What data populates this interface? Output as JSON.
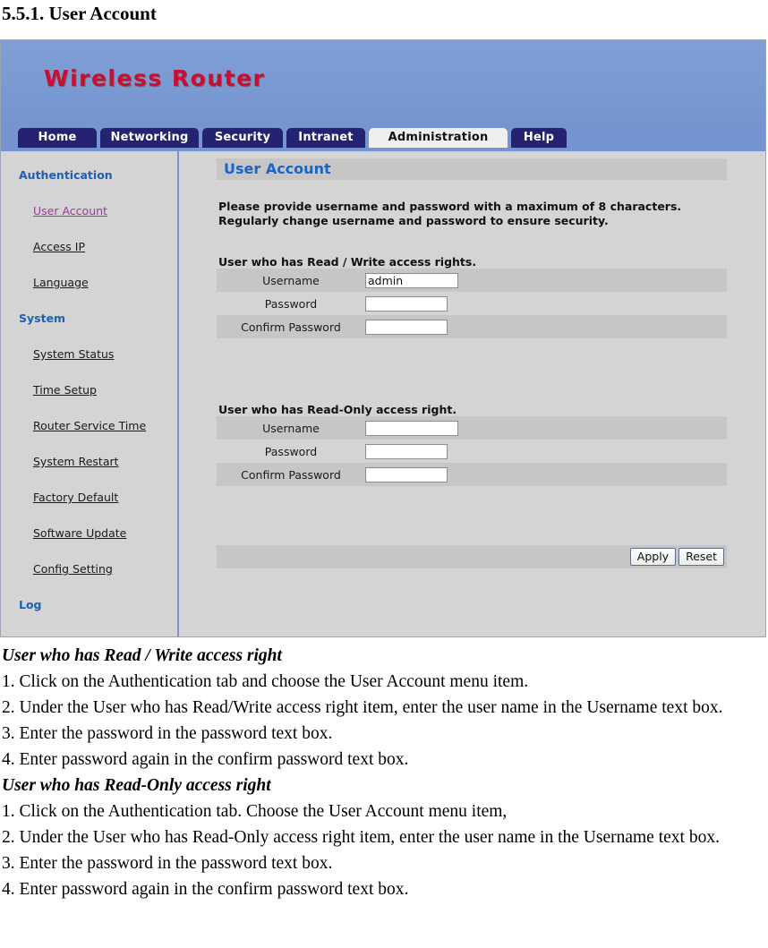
{
  "document": {
    "heading": "5.5.1. User Account"
  },
  "router_ui": {
    "brand": "Wireless Router",
    "nav_tabs": [
      {
        "label": "Home",
        "active": false
      },
      {
        "label": "Networking",
        "active": false
      },
      {
        "label": "Security",
        "active": false
      },
      {
        "label": "Intranet",
        "active": false
      },
      {
        "label": "Administration",
        "active": true
      },
      {
        "label": "Help",
        "active": false
      }
    ],
    "sidebar": {
      "groups": [
        {
          "title": "Authentication",
          "items": [
            {
              "label": "User Account",
              "current": true
            },
            {
              "label": "Access IP",
              "current": false
            },
            {
              "label": "Language",
              "current": false
            }
          ]
        },
        {
          "title": "System",
          "items": [
            {
              "label": "System Status",
              "current": false
            },
            {
              "label": "Time Setup",
              "current": false
            },
            {
              "label": "Router Service Time",
              "current": false
            },
            {
              "label": "System Restart",
              "current": false
            },
            {
              "label": "Factory Default",
              "current": false
            },
            {
              "label": "Software Update",
              "current": false
            },
            {
              "label": "Config Setting",
              "current": false
            }
          ]
        },
        {
          "title": "Log",
          "items": []
        }
      ]
    },
    "panel": {
      "title": "User Account",
      "intro_line1": "Please provide username and password with a maximum of 8 characters.",
      "intro_line2": "Regularly change username and password to ensure security.",
      "rw_group_label": "User who has Read / Write access rights.",
      "ro_group_label": "User who has Read-Only access right.",
      "rw_fields": [
        {
          "label": "Username",
          "value": "admin",
          "placeholder": ""
        },
        {
          "label": "Password",
          "value": "",
          "placeholder": ""
        },
        {
          "label": "Confirm Password",
          "value": "",
          "placeholder": ""
        }
      ],
      "ro_fields": [
        {
          "label": "Username",
          "value": "",
          "placeholder": ""
        },
        {
          "label": "Password",
          "value": "",
          "placeholder": ""
        },
        {
          "label": "Confirm Password",
          "value": "",
          "placeholder": ""
        }
      ],
      "apply_label": "Apply",
      "reset_label": "Reset"
    },
    "colors": {
      "tab_inactive_bg": "#232372",
      "tab_active_bg": "#efefef",
      "header_bg": "#7694cf",
      "brand_text": "#c8102e",
      "panel_title_text": "#1864c8",
      "sidebar_group_text": "#1d5fb4",
      "sidebar_current_link": "#a0379c",
      "row_odd_bg": "#c6c6c6",
      "row_even_bg": "#d4d4d4"
    }
  },
  "instructions": {
    "rw_heading": "User who has Read / Write access right",
    "rw_steps": [
      "1. Click on the Authentication tab and choose the User Account menu item.",
      "2. Under the User who has Read/Write access right item, enter the user name in the Username text box.",
      "3. Enter the password in the password text box.",
      "4. Enter password again in the confirm password text box."
    ],
    "ro_heading": "User who has Read-Only access right",
    "ro_steps": [
      "1. Click on the Authentication tab. Choose the User Account menu item,",
      "2. Under the User who has Read-Only access right item, enter the user name in the Username text box.",
      "3. Enter the password in the password text box.",
      "4. Enter password again in the confirm password text box."
    ]
  }
}
